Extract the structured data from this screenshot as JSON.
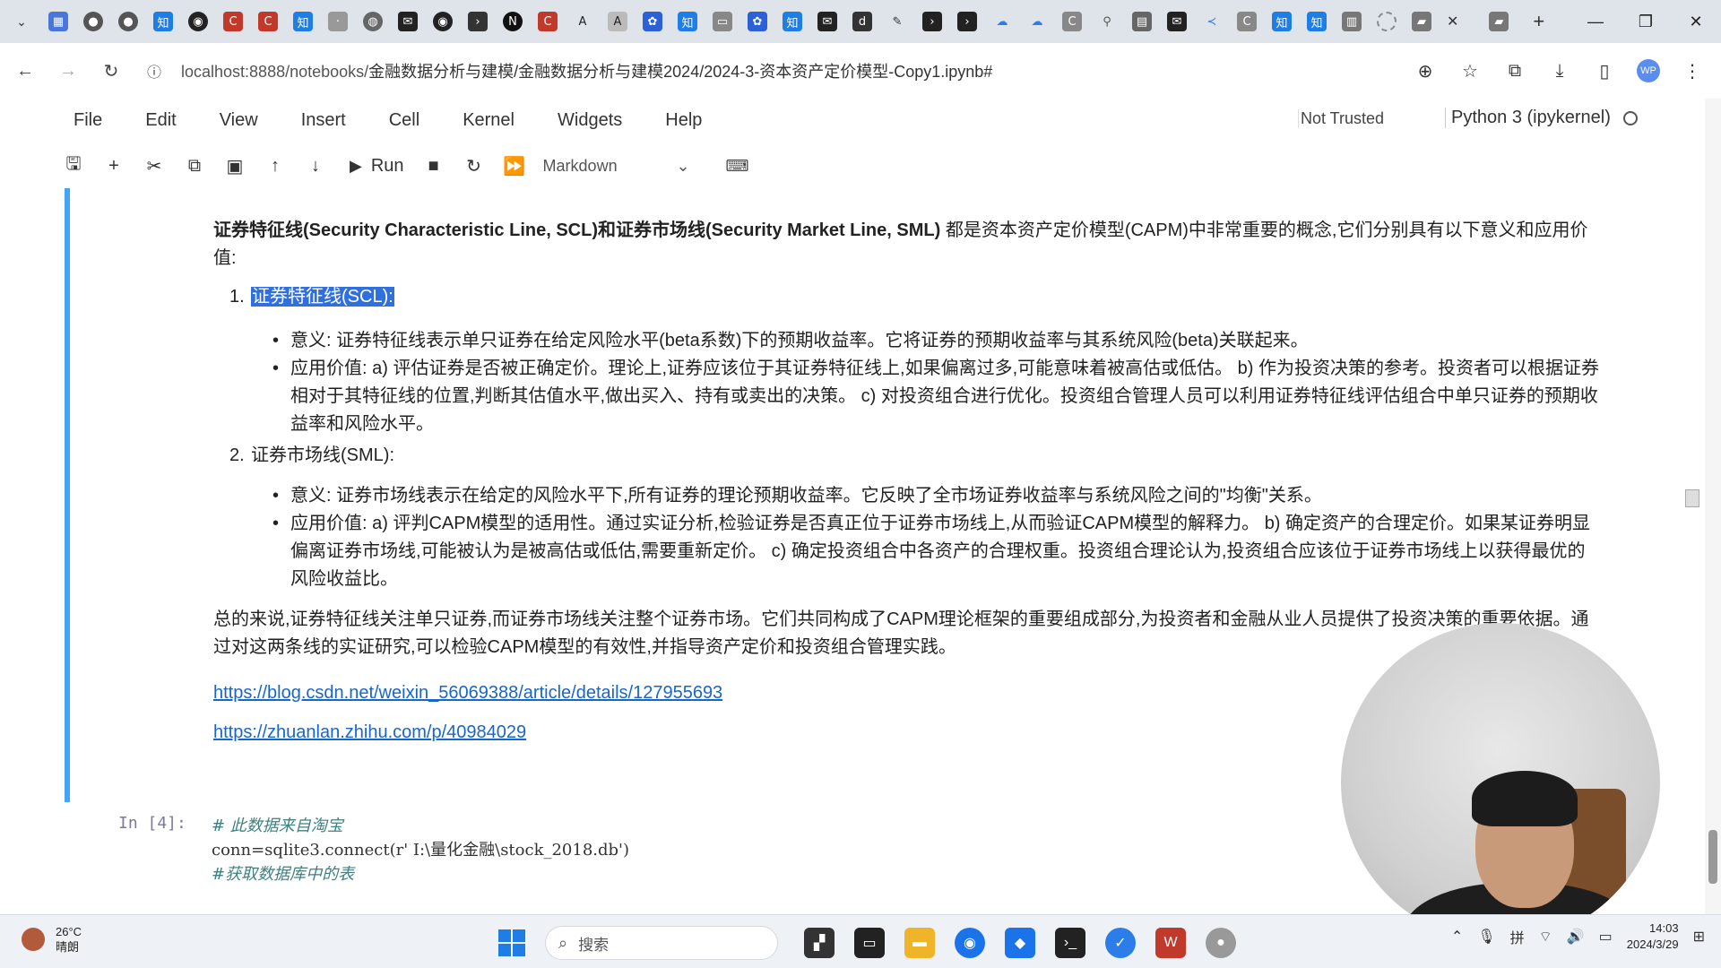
{
  "browser": {
    "tabs_icons": [
      "calendar-icon",
      "record-icon",
      "record-icon",
      "zhihu-icon",
      "github-icon",
      "c-icon",
      "c-icon",
      "zhihu-icon",
      "dot-icon",
      "globe-icon",
      "mail-icon",
      "github-icon",
      "terminal-icon",
      "notion-icon",
      "c-icon",
      "ai-icon",
      "ai-icon",
      "baidu-icon",
      "zhihu-icon",
      "image-icon",
      "baidu-icon",
      "zhihu-icon",
      "mail-icon",
      "dds-icon",
      "pen-icon",
      "terminal-icon",
      "terminal-icon",
      "cloud-icon",
      "cloud-icon",
      "c-icon",
      "runner-icon",
      "grid-icon",
      "mail-icon",
      "vscode-icon",
      "c-icon",
      "zhihu-icon",
      "zhihu-icon",
      "book-icon",
      "loading-icon",
      "doc-icon"
    ],
    "close_tab": "✕",
    "new_tab": "+",
    "url_prefix": "localhost:8888/notebooks/",
    "url_path": "金融数据分析与建模/金融数据分析与建模2024/2024-3-资本资产定价模型-Copy1.ipynb#",
    "avatar_text": "WP"
  },
  "menubar": {
    "items": [
      "File",
      "Edit",
      "View",
      "Insert",
      "Cell",
      "Kernel",
      "Widgets",
      "Help"
    ],
    "trusted": "Not Trusted",
    "kernel": "Python 3 (ipykernel)"
  },
  "toolbar": {
    "run_label": "Run",
    "cell_type": "Markdown"
  },
  "cell": {
    "intro_bold": "证券特征线(Security Characteristic Line, SCL)和证券市场线(Security Market Line, SML)",
    "intro_rest": " 都是资本资产定价模型(CAPM)中非常重要的概念,它们分别具有以下意义和应用价值:",
    "item1_num": "1.",
    "item1_title": "证券特征线(SCL):",
    "item1_b1": "意义: 证券特征线表示单只证券在给定风险水平(beta系数)下的预期收益率。它将证券的预期收益率与其系统风险(beta)关联起来。",
    "item1_b2": "应用价值: a) 评估证券是否被正确定价。理论上,证券应该位于其证券特征线上,如果偏离过多,可能意味着被高估或低估。 b) 作为投资决策的参考。投资者可以根据证券相对于其特征线的位置,判断其估值水平,做出买入、持有或卖出的决策。 c) 对投资组合进行优化。投资组合管理人员可以利用证券特征线评估组合中单只证券的预期收益率和风险水平。",
    "item2_num": "2.",
    "item2_title": "证券市场线(SML):",
    "item2_b1": "意义: 证券市场线表示在给定的风险水平下,所有证券的理论预期收益率。它反映了全市场证券收益率与系统风险之间的\"均衡\"关系。",
    "item2_b2": "应用价值: a) 评判CAPM模型的适用性。通过实证分析,检验证券是否真正位于证券市场线上,从而验证CAPM模型的解释力。 b) 确定资产的合理定价。如果某证券明显偏离证券市场线,可能被认为是被高估或低估,需要重新定价。 c) 确定投资组合中各资产的合理权重。投资组合理论认为,投资组合应该位于证券市场线上以获得最优的风险收益比。",
    "summary": "总的来说,证券特征线关注单只证券,而证券市场线关注整个证券市场。它们共同构成了CAPM理论框架的重要组成部分,为投资者和金融从业人员提供了投资决策的重要依据。通过对这两条线的实证研究,可以检验CAPM模型的有效性,并指导资产定价和投资组合管理实践。",
    "link1": "https://blog.csdn.net/weixin_56069388/article/details/127955693",
    "link2": "https://zhuanlan.zhihu.com/p/40984029"
  },
  "code_cell": {
    "prompt": "In  [4]:",
    "line1": "# 此数据来自淘宝",
    "line2": "conn=sqlite3.connect(r' I:\\量化金融\\stock_2018.db')",
    "line3": "#获取数据库中的表"
  },
  "taskbar": {
    "temp": "26°C",
    "weather": "晴朗",
    "search_placeholder": "搜索",
    "time": "14:03",
    "date": "2024/3/29"
  }
}
